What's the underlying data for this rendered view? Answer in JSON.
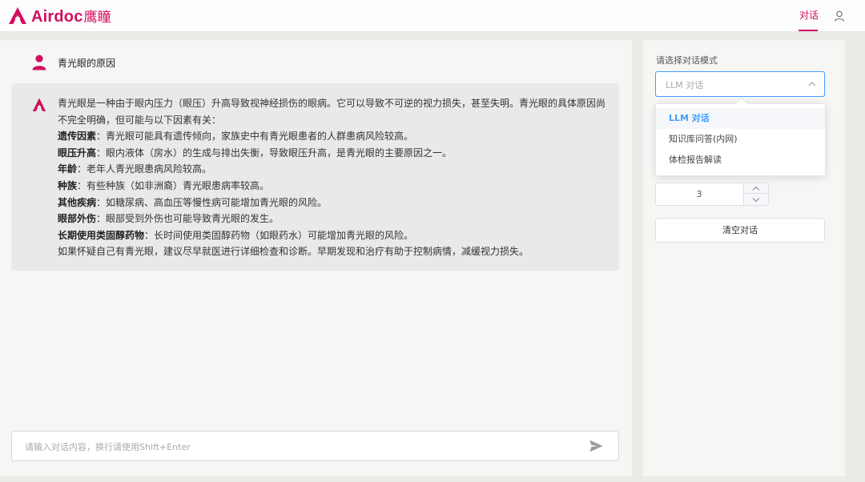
{
  "app": {
    "brand_name": "Airdoc",
    "brand_cn": "鹰瞳",
    "brand_color": "#d0105e"
  },
  "nav": {
    "active_tab": "对话",
    "user_icon": "user-icon"
  },
  "chat": {
    "question": "青光眼的原因",
    "answer": {
      "intro": "青光眼是一种由于眼内压力（眼压）升高导致视神经损伤的眼病。它可以导致不可逆的视力损失，甚至失明。青光眼的具体原因尚不完全明确，但可能与以下因素有关：",
      "factors": [
        {
          "term": "遗传因素",
          "desc": "：青光眼可能具有遗传倾向，家族史中有青光眼患者的人群患病风险较高。"
        },
        {
          "term": "眼压升高",
          "desc": "：眼内液体（房水）的生成与排出失衡，导致眼压升高，是青光眼的主要原因之一。"
        },
        {
          "term": "年龄",
          "desc": "：老年人青光眼患病风险较高。"
        },
        {
          "term": "种族",
          "desc": "：有些种族（如非洲裔）青光眼患病率较高。"
        },
        {
          "term": "其他疾病",
          "desc": "：如糖尿病、高血压等慢性病可能增加青光眼的风险。"
        },
        {
          "term": "眼部外伤",
          "desc": "：眼部受到外伤也可能导致青光眼的发生。"
        },
        {
          "term": "长期使用类固醇药物",
          "desc": "：长时间使用类固醇药物（如眼药水）可能增加青光眼的风险。"
        }
      ],
      "conclusion": "如果怀疑自己有青光眼，建议尽早就医进行详细检查和诊断。早期发现和治疗有助于控制病情，减缓视力损失。"
    },
    "input_placeholder": "请输入对话内容，换行请使用Shift+Enter",
    "send_icon": "send-icon"
  },
  "settings": {
    "mode_label": "请选择对话模式",
    "mode_selected": "LLM 对话",
    "mode_options": [
      "LLM 对话",
      "知识库问答(内网)",
      "体检报告解读"
    ],
    "history_count": "3",
    "clear_button": "清空对话",
    "accent_color": "#409eff"
  }
}
